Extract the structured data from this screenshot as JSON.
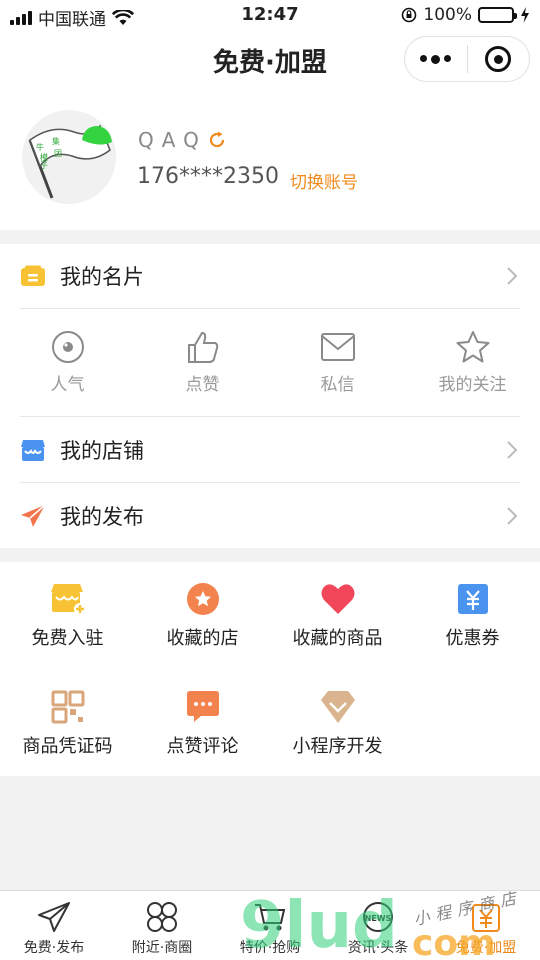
{
  "status_bar": {
    "carrier": "中国联通",
    "time": "12:47",
    "battery": "100%"
  },
  "nav": {
    "title": "免费·加盟"
  },
  "profile": {
    "nickname": "QAQ",
    "phone": "176****2350",
    "switch_label": "切换账号",
    "avatar_flag_text": [
      "牛",
      "集",
      "模",
      "团",
      "子"
    ]
  },
  "menu": {
    "card": "我的名片",
    "store": "我的店铺",
    "publish": "我的发布"
  },
  "stats": [
    {
      "label": "人气",
      "icon": "eye-icon"
    },
    {
      "label": "点赞",
      "icon": "thumbs-up-icon"
    },
    {
      "label": "私信",
      "icon": "mail-icon"
    },
    {
      "label": "我的关注",
      "icon": "star-icon"
    }
  ],
  "features": [
    {
      "label": "免费入驻",
      "icon": "store-add-icon",
      "color": "#f7c233"
    },
    {
      "label": "收藏的店",
      "icon": "star-circle-icon",
      "color": "#f2834f"
    },
    {
      "label": "收藏的商品",
      "icon": "heart-icon",
      "color": "#f2465b"
    },
    {
      "label": "优惠券",
      "icon": "coupon-icon",
      "color": "#4a94f0"
    },
    {
      "label": "商品凭证码",
      "icon": "qr-code-icon",
      "color": "#d9a57a"
    },
    {
      "label": "点赞评论",
      "icon": "comment-icon",
      "color": "#f2834f"
    },
    {
      "label": "小程序开发",
      "icon": "diamond-icon",
      "color": "#d9b48e"
    }
  ],
  "tabs": [
    {
      "label": "免费·发布",
      "icon": "paper-plane-icon"
    },
    {
      "label": "附近·商圈",
      "icon": "clover-icon"
    },
    {
      "label": "特价·抢购",
      "icon": "cart-icon"
    },
    {
      "label": "资讯·头条",
      "icon": "news-icon",
      "badge": "NEWS"
    },
    {
      "label": "免费·加盟",
      "icon": "yuan-tag-icon",
      "active": true
    }
  ],
  "watermark": {
    "text": "9lud",
    "domain": "com",
    "script": "小程序商店"
  },
  "colors": {
    "accent": "#f08a1c",
    "background": "#f2f2f2"
  }
}
